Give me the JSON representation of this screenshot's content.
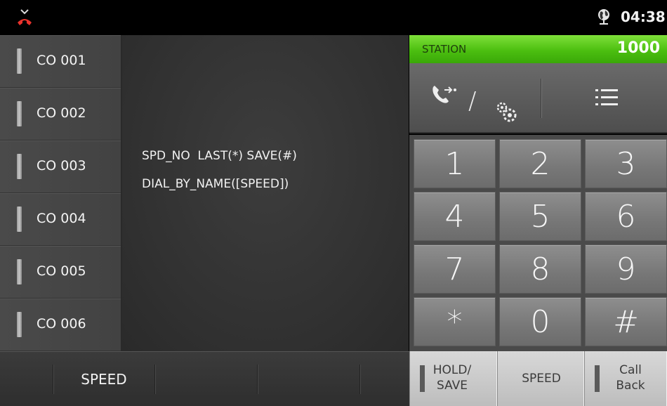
{
  "status_bar": {
    "time": "04:38",
    "icons": [
      "missed-call-icon",
      "globe-icon"
    ],
    "missed_call_color": "#e8322c"
  },
  "co_lines": [
    {
      "label": "CO 001"
    },
    {
      "label": "CO 002"
    },
    {
      "label": "CO 003"
    },
    {
      "label": "CO 004"
    },
    {
      "label": "CO 005"
    },
    {
      "label": "CO 006"
    }
  ],
  "display": {
    "line1": "SPD_NO  LAST(*) SAVE(#)",
    "line2": "DIAL_BY_NAME([SPEED])"
  },
  "station": {
    "label": "STATION",
    "number": "1000",
    "color": "#4cbf10"
  },
  "function_bar": {
    "left_icons": [
      "transfer-icon",
      "settings-icon"
    ],
    "separator": "/",
    "right_icon": "menu-list-icon"
  },
  "keypad": [
    "1",
    "2",
    "3",
    "4",
    "5",
    "6",
    "7",
    "8",
    "9",
    "*",
    "0",
    "#"
  ],
  "soft_keys": {
    "speed": "SPEED"
  },
  "bottom_buttons": {
    "hold_save": [
      "HOLD/",
      "SAVE"
    ],
    "speed": "SPEED",
    "call_back": [
      "Call",
      "Back"
    ]
  }
}
